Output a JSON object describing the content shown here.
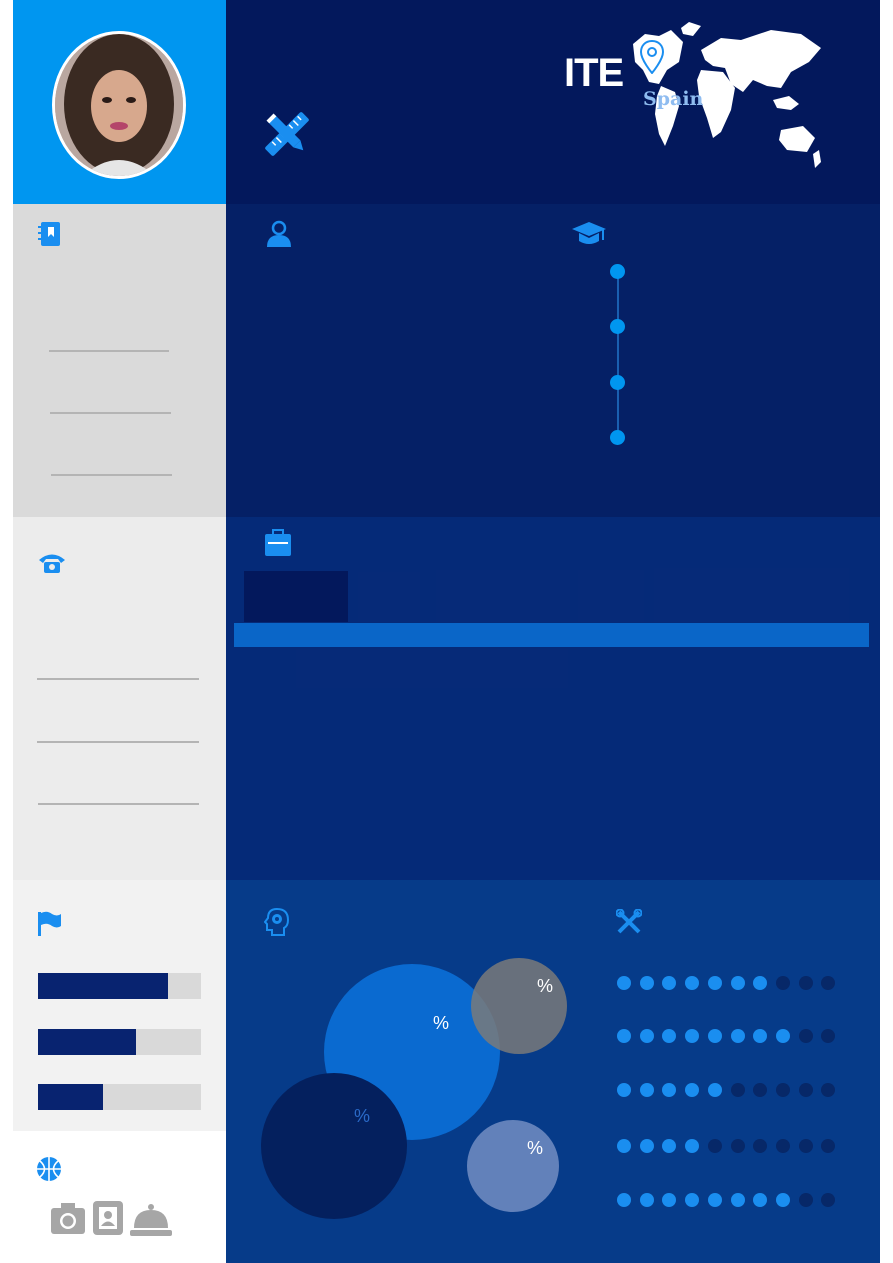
{
  "header": {
    "title_fragment": "ITE",
    "map_label": "Spain"
  },
  "skills": [
    {
      "filled": 7,
      "total": 10
    },
    {
      "filled": 8,
      "total": 10
    },
    {
      "filled": 5,
      "total": 10
    },
    {
      "filled": 4,
      "total": 10
    },
    {
      "filled": 8,
      "total": 10
    }
  ],
  "language_levels": [
    0.8,
    0.6,
    0.4
  ],
  "bubbles": [
    {
      "label": "%"
    },
    {
      "label": "%"
    },
    {
      "label": "%"
    },
    {
      "label": "%"
    }
  ],
  "colors": {
    "accent": "#0096f0",
    "dark_navy": "#03185c",
    "dot_on": "#1a8ef0",
    "dot_off": "#072868"
  },
  "icons": [
    "pencil-ruler-icon",
    "notebook-icon",
    "user-icon",
    "graduation-cap-icon",
    "phone-icon",
    "briefcase-icon",
    "flag-icon",
    "brain-gear-icon",
    "tools-icon",
    "basketball-icon",
    "camera-icon",
    "contact-card-icon",
    "service-bell-icon",
    "location-pin-icon"
  ]
}
